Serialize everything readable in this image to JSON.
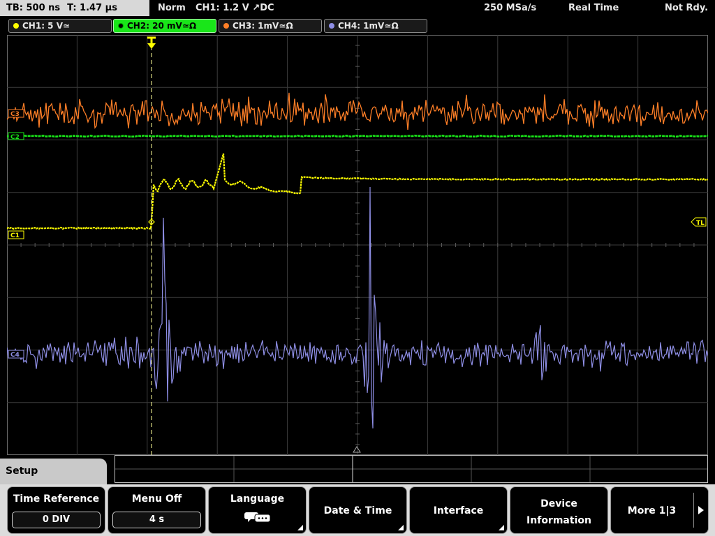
{
  "topbar": {
    "timebase": "TB: 500 ns",
    "trigger_time": "T: 1.47 µs",
    "mode": "Norm",
    "trigger": "CH1: 1.2 V ↗DC",
    "sample_rate": "250 MSa/s",
    "acq_mode": "Real Time",
    "status": "Not Rdy."
  },
  "channels": [
    {
      "label": "CH1: 5 V≃",
      "color": "#ffff00",
      "active": false
    },
    {
      "label": "CH2: 20 mV≃Ω",
      "color": "#19e619",
      "active": true
    },
    {
      "label": "CH3: 1mV≃Ω",
      "color": "#ff7f27",
      "active": false
    },
    {
      "label": "CH4: 1mV≃Ω",
      "color": "#8f8fe6",
      "active": false
    }
  ],
  "markers": {
    "ch1": "C1",
    "ch2": "C2",
    "ch3": "C3",
    "ch4": "C4",
    "trigger_level": "TL",
    "trigger_pos": "T"
  },
  "menu": {
    "title": "Setup",
    "time_reference": {
      "label": "Time Reference",
      "value": "0 DIV"
    },
    "menu_off": {
      "label": "Menu Off",
      "value": "4 s"
    },
    "language": {
      "label": "Language",
      "icon": "speech-bubbles-icon"
    },
    "date_time": {
      "label": "Date & Time"
    },
    "interface": {
      "label": "Interface"
    },
    "device_info": {
      "label_line1": "Device",
      "label_line2": "Information"
    },
    "more": {
      "label": "More 1|3"
    }
  },
  "colors": {
    "ch1": "#ffff00",
    "ch2": "#19e619",
    "ch3": "#ff7f27",
    "ch4": "#8f8fe6",
    "grid": "#3c3c3c"
  }
}
